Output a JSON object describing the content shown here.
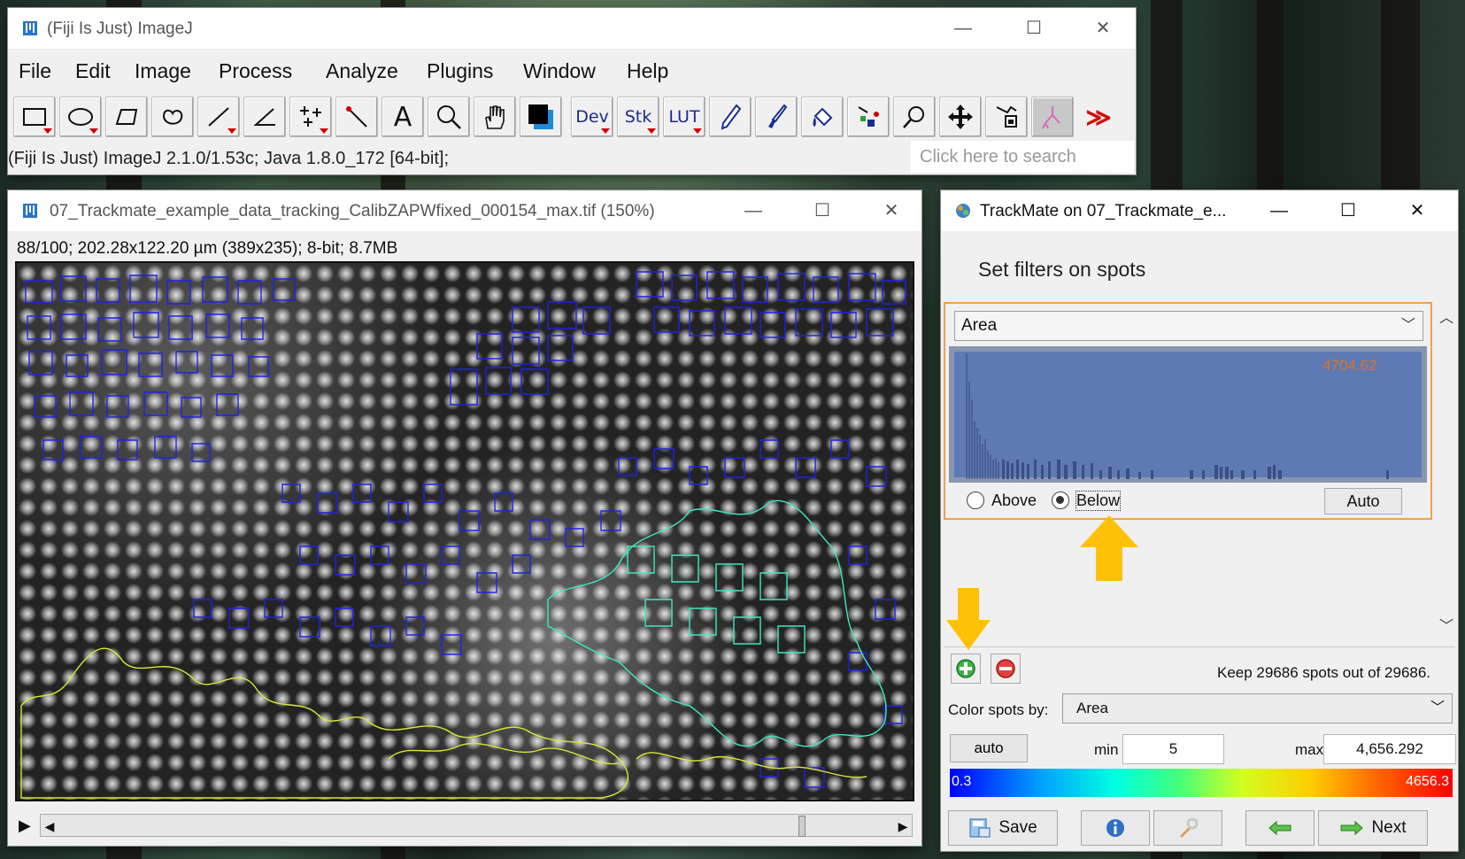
{
  "imagej": {
    "title": "(Fiji Is Just) ImageJ",
    "menu": [
      "File",
      "Edit",
      "Image",
      "Process",
      "Analyze",
      "Plugins",
      "Window",
      "Help"
    ],
    "tools": {
      "dev": "Dev",
      "stk": "Stk",
      "lut": "LUT",
      "text_tool": "A"
    },
    "status": "(Fiji Is Just) ImageJ 2.1.0/1.53c; Java 1.8.0_172 [64-bit];",
    "search_placeholder": "Click here to search"
  },
  "image_window": {
    "title": "07_Trackmate_example_data_tracking_CalibZAPWfixed_000154_max.tif (150%)",
    "info": "88/100; 202.28x122.20 µm (389x235); 8-bit; 8.7MB"
  },
  "trackmate": {
    "title": "TrackMate on 07_Trackmate_e...",
    "step_title": "Set filters on spots",
    "filter": {
      "feature": "Area",
      "threshold": "4704.62",
      "above_label": "Above",
      "below_label": "Below",
      "selected": "Below",
      "auto_label": "Auto"
    },
    "keep_text": "Keep 29686 spots out of  29686.",
    "color_by_label": "Color spots by:",
    "color_by_value": "Area",
    "auto_label": "auto",
    "min_label": "min",
    "min_value": "5",
    "max_label": "max",
    "max_value": "4,656.292",
    "range_min": "0.3",
    "range_max": "4656.3",
    "save_label": "Save",
    "next_label": "Next"
  },
  "colors": {
    "accent_orange": "#f0a050",
    "arrow_yellow": "#ffc107",
    "histogram_bg": "#5d7ab5",
    "threshold_text": "#d9722a"
  }
}
